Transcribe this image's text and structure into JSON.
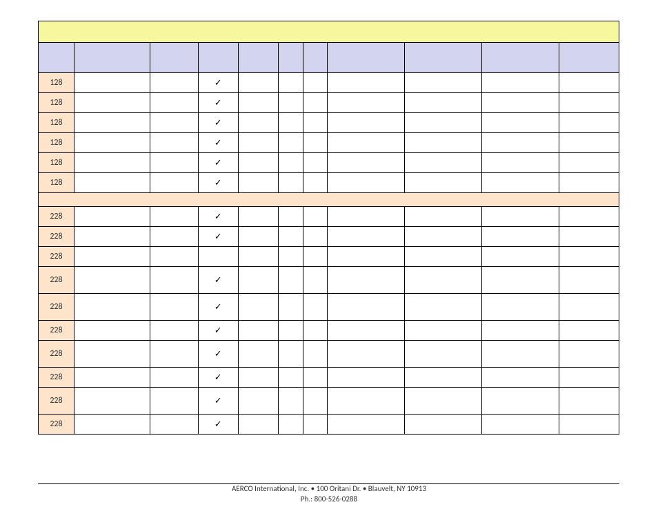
{
  "checkmark": "✓",
  "section1": {
    "rows": [
      {
        "id": "128",
        "check": true
      },
      {
        "id": "128",
        "check": true
      },
      {
        "id": "128",
        "check": true
      },
      {
        "id": "128",
        "check": true
      },
      {
        "id": "128",
        "check": true
      },
      {
        "id": "128",
        "check": true
      }
    ]
  },
  "section2": {
    "rows": [
      {
        "id": "228",
        "check": true,
        "tall": false
      },
      {
        "id": "228",
        "check": true,
        "tall": false
      },
      {
        "id": "228",
        "check": false,
        "tall": false
      },
      {
        "id": "228",
        "check": true,
        "tall": true
      },
      {
        "id": "228",
        "check": true,
        "tall": true
      },
      {
        "id": "228",
        "check": true,
        "tall": false
      },
      {
        "id": "228",
        "check": true,
        "tall": true
      },
      {
        "id": "228",
        "check": true,
        "tall": false
      },
      {
        "id": "228",
        "check": true,
        "tall": true
      },
      {
        "id": "228",
        "check": true,
        "tall": false
      }
    ]
  },
  "footer": {
    "line1": "AERCO International, Inc. • 100 Oritani Dr. • Blauvelt, NY 10913",
    "line2": "Ph.: 800-526-0288"
  }
}
